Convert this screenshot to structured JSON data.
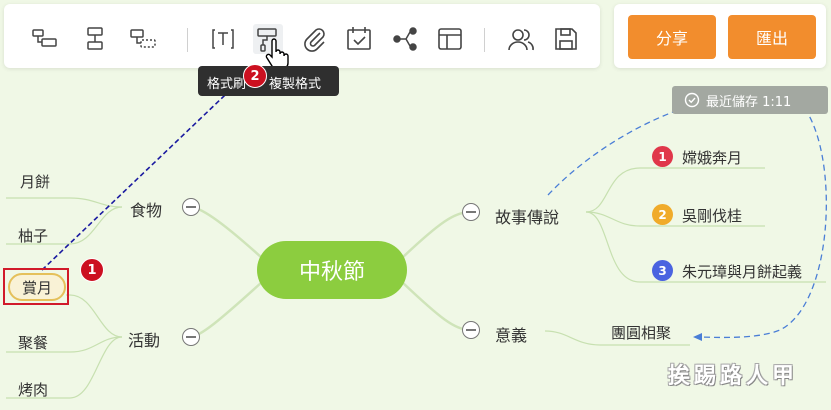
{
  "toolbar": {
    "icons": [
      "add-child-topic-icon",
      "add-sibling-topic-icon",
      "add-floating-topic-icon",
      "text-icon",
      "format-painter-icon",
      "attachment-icon",
      "calendar-icon",
      "relationship-icon",
      "layout-icon",
      "users-icon",
      "save-icon"
    ],
    "share_label": "分享",
    "export_label": "匯出",
    "accent": "#f28d2d"
  },
  "tooltip": {
    "covered_text": "格式刷",
    "text": "複製格式"
  },
  "step_badges": {
    "one": "1",
    "two": "2",
    "color": "#cc1020"
  },
  "saved_status": "最近儲存 1:11",
  "mindmap": {
    "central": "中秋節",
    "central_color": "#8ccd3f",
    "left_branches": [
      {
        "label": "食物",
        "children": [
          "月餅",
          "柚子"
        ]
      },
      {
        "label": "活動",
        "children": [
          "賞月",
          "聚餐",
          "烤肉"
        ]
      }
    ],
    "right_branches": [
      {
        "label": "故事傳說",
        "children": [
          {
            "num": "1",
            "text": "嫦娥奔月",
            "color": "#e0374a"
          },
          {
            "num": "2",
            "text": "吳剛伐桂",
            "color": "#f0ab2a"
          },
          {
            "num": "3",
            "text": "朱元璋與月餅起義",
            "color": "#4a63e0"
          }
        ]
      },
      {
        "label": "意義",
        "children": [
          {
            "text": "團圓相聚"
          }
        ]
      }
    ]
  },
  "watermark": "挨踢路人甲"
}
